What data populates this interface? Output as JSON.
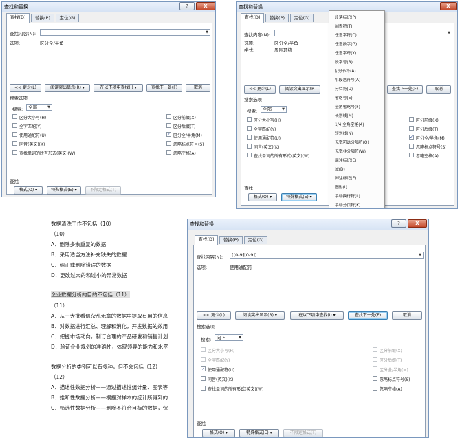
{
  "dialog1": {
    "title": "查找和替换",
    "window_buttons": [
      "?",
      "X"
    ],
    "tabs": [
      "查找(D)",
      "替换(P)",
      "定位(G)"
    ],
    "find_label": "查找内容(N):",
    "find_value": "",
    "options_label": "选项:",
    "options_value": "区分全/半角",
    "buttons": {
      "less": "<< 更少(L)",
      "reading_highlight": "阅读突出显示(R) ▾",
      "find_in": "在以下项中查找(I) ▾",
      "find_next": "查找下一处(F)",
      "cancel": "取消"
    },
    "search_options_label": "搜索选项",
    "search_label": "搜索:",
    "search_value": "全部",
    "checkboxes_left": [
      {
        "label": "区分大小写(H)",
        "checked": false
      },
      {
        "label": "全字匹配(Y)",
        "checked": false
      },
      {
        "label": "使用通配符(U)",
        "checked": false
      },
      {
        "label": "同音(英文)(K)",
        "checked": false
      },
      {
        "label": "查找单词的所有形式(英文)(W)",
        "checked": false
      }
    ],
    "checkboxes_right": [
      {
        "label": "区分前缀(X)",
        "checked": false
      },
      {
        "label": "区分后缀(T)",
        "checked": false
      },
      {
        "label": "区分全/半角(M)",
        "checked": true
      },
      {
        "label": "忽略标点符号(S)",
        "checked": false
      },
      {
        "label": "忽略空格(A)",
        "checked": false
      }
    ],
    "find_section": "查找",
    "bottom_buttons": [
      "格式(O) ▾",
      "特殊格式(E) ▾",
      "不限定格式(T)"
    ]
  },
  "dialog2": {
    "title": "查找和替换",
    "window_buttons": [
      "X"
    ],
    "tabs": [
      "查找(D)",
      "替换(P)",
      "定位(G)"
    ],
    "find_label": "查找内容(N):",
    "options_label": "选项:",
    "options_value": "区分全/半角",
    "format_label": "格式:",
    "format_value": "周围环绕",
    "buttons": {
      "less": "<< 更少(L)",
      "reading_highlight": "阅读突出显示(R",
      "find_next": "查找下一处(F)",
      "cancel": "取消"
    },
    "search_options_label": "搜索选项",
    "search_label": "搜索:",
    "search_value": "全部",
    "checkboxes_left": [
      {
        "label": "区分大小写(H)",
        "checked": false
      },
      {
        "label": "全字匹配(Y)",
        "checked": false
      },
      {
        "label": "使用通配符(U)",
        "checked": false
      },
      {
        "label": "同音(英文)(K)",
        "checked": false
      },
      {
        "label": "查找单词的所有形式(英文)(W)",
        "checked": false
      }
    ],
    "checkboxes_right": [
      {
        "label": "区分前缀(X)",
        "checked": false
      },
      {
        "label": "区分后缀(T)",
        "checked": false
      },
      {
        "label": "区分全/半角(M)",
        "checked": true
      },
      {
        "label": "忽略标点符号(S)",
        "checked": false
      },
      {
        "label": "忽略空格(A)",
        "checked": false
      }
    ],
    "find_section": "查找",
    "bottom_buttons": [
      "格式(O) ▾",
      "特殊格式(E) ▾"
    ],
    "special_menu": [
      "段落标记(P)",
      "制表符(T)",
      "任意字符(C)",
      "任意数字(G)",
      "任意字母(Y)",
      "脱字号(R)",
      "§ 分节符(A)",
      "¶ 段落符号(A)",
      "分栏符(U)",
      "省略号(E)",
      "全角省略号(F)",
      "长划线(M)",
      "1/4 全角空格(4)",
      "短划线(N)",
      "无宽可选分隔符(O)",
      "无宽非分隔符(W)",
      "尾注标记(E)",
      "域(D)",
      "脚注标记(E)",
      "图形(I)",
      "手动换行符(L)",
      "手动分页符(K)"
    ]
  },
  "dialog3": {
    "title": "查找和替换",
    "window_buttons": [
      "?",
      "X"
    ],
    "tabs": [
      "查找(D)",
      "替换(P)",
      "定位(G)"
    ],
    "find_label": "查找内容(N):",
    "find_value": "([0-9][0-9])",
    "options_label": "选项:",
    "options_value": "使用通配符",
    "buttons": {
      "less": "<< 更少(L)",
      "reading_highlight": "阅读突出显示(R) ▾",
      "find_in": "在以下项中查找(I) ▾",
      "find_next": "查找下一处(F)",
      "cancel": "取消"
    },
    "search_options_label": "搜索选项",
    "search_label": "搜索:",
    "search_value": "向下",
    "checkboxes_left": [
      {
        "label": "区分大小写(H)",
        "checked": false,
        "disabled": true
      },
      {
        "label": "全字匹配(Y)",
        "checked": false,
        "disabled": true
      },
      {
        "label": "使用通配符(U)",
        "checked": true,
        "disabled": false
      },
      {
        "label": "同音(英文)(K)",
        "checked": false,
        "disabled": false
      },
      {
        "label": "查找单词的所有形式(英文)(W)",
        "checked": false,
        "disabled": false
      }
    ],
    "checkboxes_right": [
      {
        "label": "区分前缀(X)",
        "checked": false,
        "disabled": true
      },
      {
        "label": "区分后缀(T)",
        "checked": false,
        "disabled": true
      },
      {
        "label": "区分全/半角(M)",
        "checked": false,
        "disabled": true
      },
      {
        "label": "忽略标点符号(S)",
        "checked": false,
        "disabled": false
      },
      {
        "label": "忽略空格(A)",
        "checked": false,
        "disabled": false
      }
    ],
    "find_section": "查找",
    "bottom_buttons": [
      "格式(O) ▾",
      "特殊格式(E) ▾",
      "不限定格式(T)"
    ]
  },
  "document": {
    "lines": [
      "数据清洗工作不包括（10）",
      "（10）",
      "A．删除多余重复的数据",
      "B．采用适当方法补充缺失的数据",
      "C．纠正或删除错误的数据",
      "D．更改过大的和过小的异常数据",
      "企业数据分析的目的不包括（11）",
      "（11）",
      "A．从一大批看似杂乱无章的数据中提取有用的信息",
      "B．对数据进行汇总、理解和消化，开发数据的效用",
      "C．把握市场动向，制订合理的产品研发和销售计划",
      "D．验证企业规划的准确性，体现领导的能力和水平",
      "数据分析的类别可以有多种，但不会包括（12）",
      "（12）",
      "A．描述性数据分析——通过描述性统计量、图表等",
      "B．推断性数据分析——根据对样本的统计所得到的",
      "C．筛选性数据分析——删除不符合目标的数据，保"
    ]
  }
}
